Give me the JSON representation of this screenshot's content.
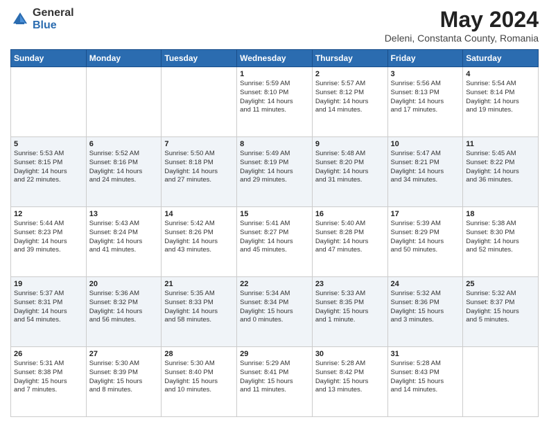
{
  "header": {
    "logo_general": "General",
    "logo_blue": "Blue",
    "title": "May 2024",
    "location": "Deleni, Constanta County, Romania"
  },
  "weekdays": [
    "Sunday",
    "Monday",
    "Tuesday",
    "Wednesday",
    "Thursday",
    "Friday",
    "Saturday"
  ],
  "weeks": [
    [
      {
        "day": "",
        "info": ""
      },
      {
        "day": "",
        "info": ""
      },
      {
        "day": "",
        "info": ""
      },
      {
        "day": "1",
        "info": "Sunrise: 5:59 AM\nSunset: 8:10 PM\nDaylight: 14 hours\nand 11 minutes."
      },
      {
        "day": "2",
        "info": "Sunrise: 5:57 AM\nSunset: 8:12 PM\nDaylight: 14 hours\nand 14 minutes."
      },
      {
        "day": "3",
        "info": "Sunrise: 5:56 AM\nSunset: 8:13 PM\nDaylight: 14 hours\nand 17 minutes."
      },
      {
        "day": "4",
        "info": "Sunrise: 5:54 AM\nSunset: 8:14 PM\nDaylight: 14 hours\nand 19 minutes."
      }
    ],
    [
      {
        "day": "5",
        "info": "Sunrise: 5:53 AM\nSunset: 8:15 PM\nDaylight: 14 hours\nand 22 minutes."
      },
      {
        "day": "6",
        "info": "Sunrise: 5:52 AM\nSunset: 8:16 PM\nDaylight: 14 hours\nand 24 minutes."
      },
      {
        "day": "7",
        "info": "Sunrise: 5:50 AM\nSunset: 8:18 PM\nDaylight: 14 hours\nand 27 minutes."
      },
      {
        "day": "8",
        "info": "Sunrise: 5:49 AM\nSunset: 8:19 PM\nDaylight: 14 hours\nand 29 minutes."
      },
      {
        "day": "9",
        "info": "Sunrise: 5:48 AM\nSunset: 8:20 PM\nDaylight: 14 hours\nand 31 minutes."
      },
      {
        "day": "10",
        "info": "Sunrise: 5:47 AM\nSunset: 8:21 PM\nDaylight: 14 hours\nand 34 minutes."
      },
      {
        "day": "11",
        "info": "Sunrise: 5:45 AM\nSunset: 8:22 PM\nDaylight: 14 hours\nand 36 minutes."
      }
    ],
    [
      {
        "day": "12",
        "info": "Sunrise: 5:44 AM\nSunset: 8:23 PM\nDaylight: 14 hours\nand 39 minutes."
      },
      {
        "day": "13",
        "info": "Sunrise: 5:43 AM\nSunset: 8:24 PM\nDaylight: 14 hours\nand 41 minutes."
      },
      {
        "day": "14",
        "info": "Sunrise: 5:42 AM\nSunset: 8:26 PM\nDaylight: 14 hours\nand 43 minutes."
      },
      {
        "day": "15",
        "info": "Sunrise: 5:41 AM\nSunset: 8:27 PM\nDaylight: 14 hours\nand 45 minutes."
      },
      {
        "day": "16",
        "info": "Sunrise: 5:40 AM\nSunset: 8:28 PM\nDaylight: 14 hours\nand 47 minutes."
      },
      {
        "day": "17",
        "info": "Sunrise: 5:39 AM\nSunset: 8:29 PM\nDaylight: 14 hours\nand 50 minutes."
      },
      {
        "day": "18",
        "info": "Sunrise: 5:38 AM\nSunset: 8:30 PM\nDaylight: 14 hours\nand 52 minutes."
      }
    ],
    [
      {
        "day": "19",
        "info": "Sunrise: 5:37 AM\nSunset: 8:31 PM\nDaylight: 14 hours\nand 54 minutes."
      },
      {
        "day": "20",
        "info": "Sunrise: 5:36 AM\nSunset: 8:32 PM\nDaylight: 14 hours\nand 56 minutes."
      },
      {
        "day": "21",
        "info": "Sunrise: 5:35 AM\nSunset: 8:33 PM\nDaylight: 14 hours\nand 58 minutes."
      },
      {
        "day": "22",
        "info": "Sunrise: 5:34 AM\nSunset: 8:34 PM\nDaylight: 15 hours\nand 0 minutes."
      },
      {
        "day": "23",
        "info": "Sunrise: 5:33 AM\nSunset: 8:35 PM\nDaylight: 15 hours\nand 1 minute."
      },
      {
        "day": "24",
        "info": "Sunrise: 5:32 AM\nSunset: 8:36 PM\nDaylight: 15 hours\nand 3 minutes."
      },
      {
        "day": "25",
        "info": "Sunrise: 5:32 AM\nSunset: 8:37 PM\nDaylight: 15 hours\nand 5 minutes."
      }
    ],
    [
      {
        "day": "26",
        "info": "Sunrise: 5:31 AM\nSunset: 8:38 PM\nDaylight: 15 hours\nand 7 minutes."
      },
      {
        "day": "27",
        "info": "Sunrise: 5:30 AM\nSunset: 8:39 PM\nDaylight: 15 hours\nand 8 minutes."
      },
      {
        "day": "28",
        "info": "Sunrise: 5:30 AM\nSunset: 8:40 PM\nDaylight: 15 hours\nand 10 minutes."
      },
      {
        "day": "29",
        "info": "Sunrise: 5:29 AM\nSunset: 8:41 PM\nDaylight: 15 hours\nand 11 minutes."
      },
      {
        "day": "30",
        "info": "Sunrise: 5:28 AM\nSunset: 8:42 PM\nDaylight: 15 hours\nand 13 minutes."
      },
      {
        "day": "31",
        "info": "Sunrise: 5:28 AM\nSunset: 8:43 PM\nDaylight: 15 hours\nand 14 minutes."
      },
      {
        "day": "",
        "info": ""
      }
    ]
  ]
}
